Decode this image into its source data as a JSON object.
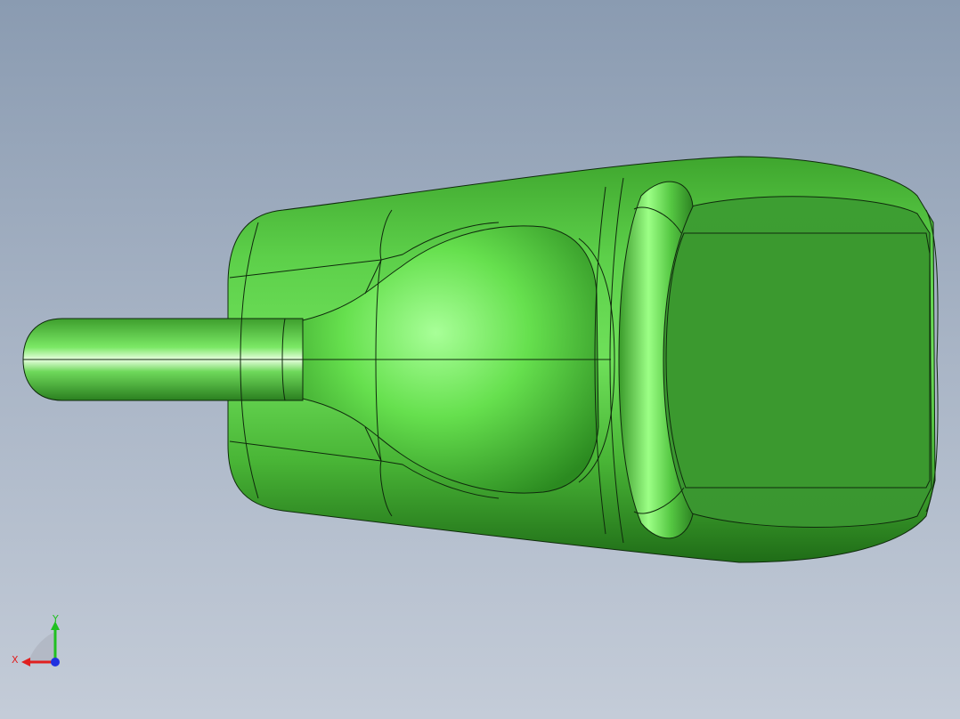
{
  "viewport": {
    "background_top": "#8a9bb1",
    "background_bottom": "#c4ccd8"
  },
  "model": {
    "color": "#4fbf3a",
    "highlight": "#b8ffb0",
    "shadow": "#1c6e16",
    "edge_color": "#0f2a0c"
  },
  "triad": {
    "x_label": "X",
    "y_label": "Y",
    "x_color": "#e02020",
    "y_color": "#20c020",
    "z_color": "#2030e0"
  }
}
